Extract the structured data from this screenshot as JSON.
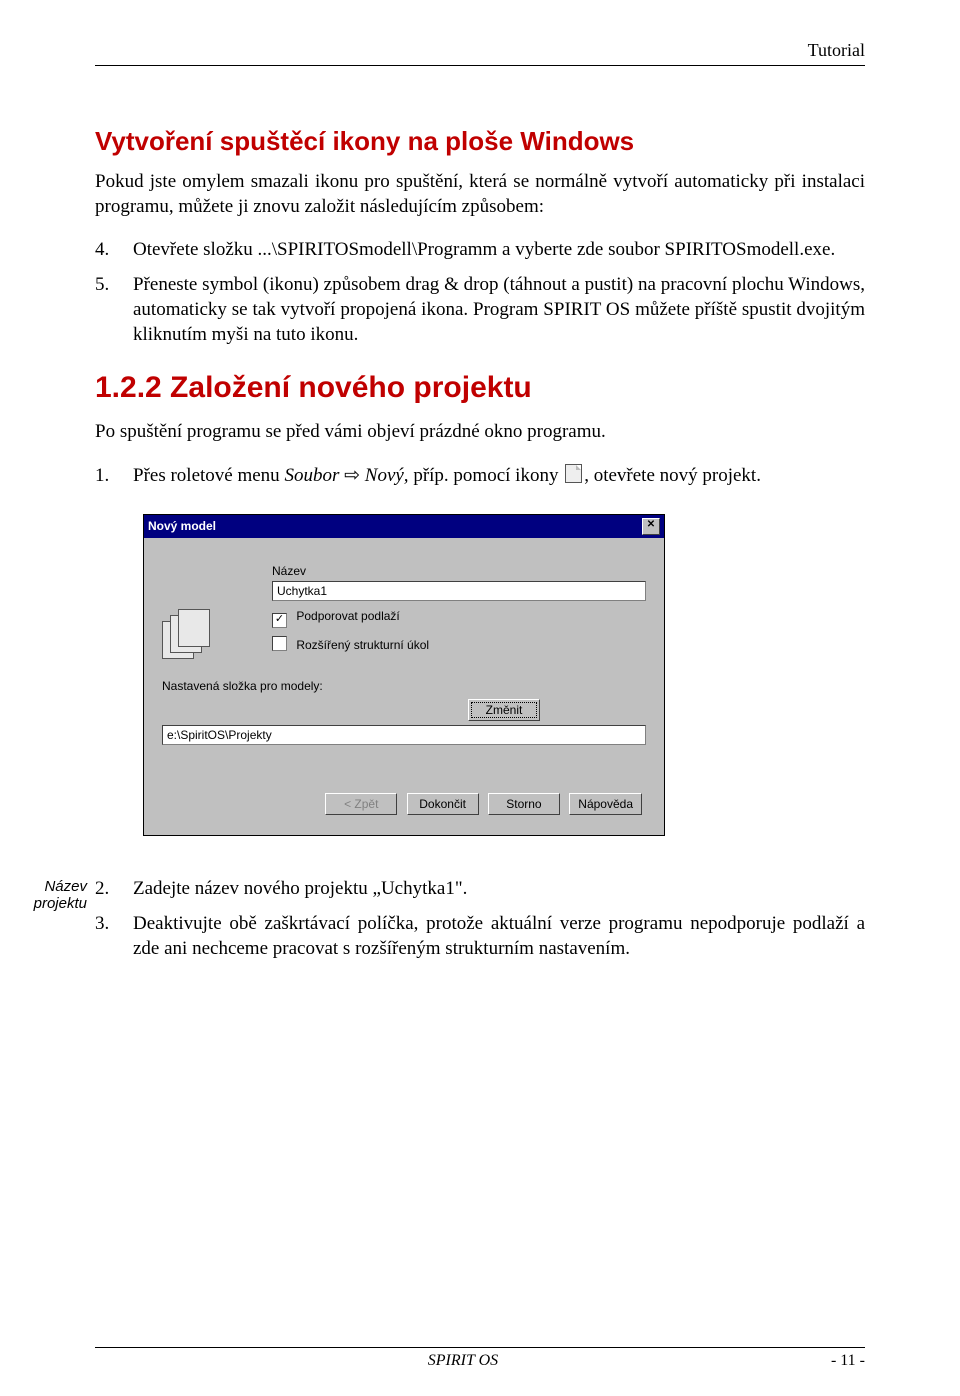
{
  "header": {
    "section": "Tutorial"
  },
  "section1": {
    "title": "Vytvoření spuštěcí ikony na ploše Windows",
    "intro": "Pokud jste omylem smazali ikonu pro spuštění, která se normálně vytvoří automaticky při instalaci programu, můžete ji znovu založit následujícím způsobem:",
    "step4_num": "4.",
    "step4_text": "Otevřete složku ...\\SPIRITOSmodell\\Programm a vyberte zde soubor SPIRITOSmodell.exe.",
    "step5_num": "5.",
    "step5_text": "Přeneste symbol (ikonu) způsobem drag & drop (táhnout a pustit) na pracovní plochu Windows, automaticky se tak vytvoří propojená ikona. Program SPIRIT OS můžete příště spustit dvojitým kliknutím myši na tuto ikonu."
  },
  "section2": {
    "title": "1.2.2  Založení nového projektu",
    "intro": "Po spuštění programu se před vámi objeví prázdné okno programu.",
    "step1_num": "1.",
    "step1_a": "Přes roletové menu ",
    "step1_menu": "Soubor",
    "step1_arrow": "⇨",
    "step1_item": "Nový,",
    "step1_b": " příp. pomocí ikony ",
    "step1_c": ", otevřete nový projekt."
  },
  "dialog": {
    "title": "Nový model",
    "close_glyph": "✕",
    "name_label": "Název",
    "name_value": "Uchytka1",
    "chk1_checked": "✓",
    "chk1_label": "Podporovat podlaží",
    "chk2_label": "Rozšířený strukturní úkol",
    "folder_label": "Nastavená složka pro modely:",
    "change_btn": "Změnit",
    "folder_value": "e:\\SpiritOS\\Projekty",
    "buttons": {
      "back": "< Zpět",
      "finish": "Dokončit",
      "cancel": "Storno",
      "help": "Nápověda"
    }
  },
  "margin_note": "Název projektu",
  "section3": {
    "step2_num": "2.",
    "step2_text": "Zadejte název nového projektu „Uchytka1\".",
    "step3_num": "3.",
    "step3_text": "Deaktivujte obě zaškrtávací políčka, protože aktuální verze programu nepodporuje podlaží a zde ani nechceme pracovat s rozšířeným strukturním nastavením."
  },
  "footer": {
    "center": "SPIRIT OS",
    "right": "- 11 -"
  }
}
